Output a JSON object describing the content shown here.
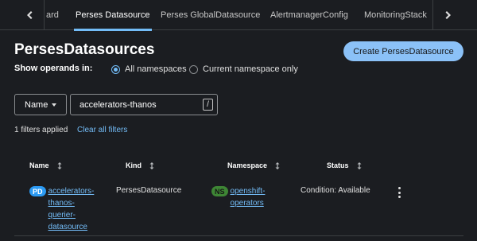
{
  "tabs": {
    "items": [
      "ard",
      "Perses Datasource",
      "Perses GlobalDatasource",
      "AlertmanagerConfig",
      "MonitoringStack"
    ],
    "active_index": 1
  },
  "header": {
    "title": "PersesDatasources",
    "create_button": "Create PersesDatasource"
  },
  "operands": {
    "label": "Show operands in:",
    "options": [
      "All namespaces",
      "Current namespace only"
    ],
    "selected": "All namespaces"
  },
  "filter": {
    "type_label": "Name",
    "value": "accelerators-thanos",
    "shortcut_key": "/",
    "applied_text": "1 filters applied",
    "clear_label": "Clear all filters"
  },
  "table": {
    "columns": [
      "Name",
      "Kind",
      "Namespace",
      "Status"
    ],
    "rows": [
      {
        "badge": "PD",
        "name": "accelerators-thanos-querier-datasource",
        "name_lines": [
          "accelerators-",
          "thanos-",
          "querier-",
          "datasource"
        ],
        "kind": "PersesDatasource",
        "namespace_badge": "NS",
        "namespace_lines": [
          "openshift-",
          "operators"
        ],
        "status": "Condition: Available"
      }
    ]
  },
  "colors": {
    "background": "#1b1d21",
    "accent": "#73bcf7",
    "primary_button": "#8bc1f7",
    "pd_badge": "#2b9af3",
    "ns_badge": "#3e8635"
  }
}
